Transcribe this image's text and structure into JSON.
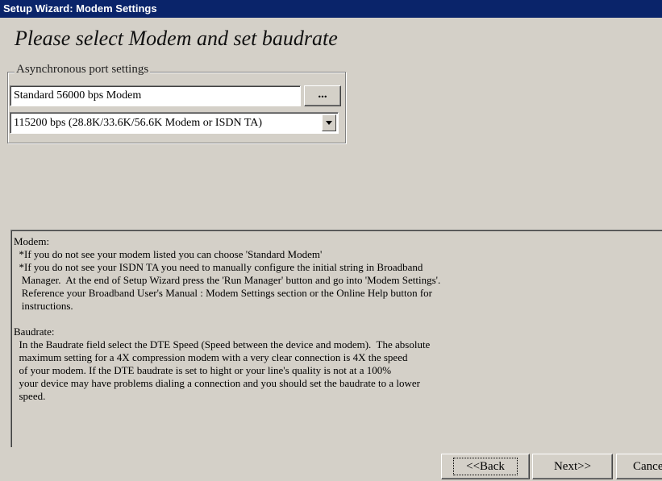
{
  "window": {
    "title": "Setup Wizard: Modem Settings"
  },
  "heading": "Please select Modem and set baudrate",
  "port_settings": {
    "group_label": "Asynchronous port settings",
    "modem_value": "Standard 56000 bps Modem",
    "browse_label": "...",
    "baud_selected": "115200 bps (28.8K/33.6K/56.6K Modem or ISDN TA)"
  },
  "info_text": {
    "lines": [
      "Modem:",
      "  *If you do not see your modem listed you can choose 'Standard Modem'",
      "  *If you do not see your ISDN TA you need to manually configure the initial string in Broadband",
      "   Manager.  At the end of Setup Wizard press the 'Run Manager' button and go into 'Modem Settings'.",
      "   Reference your Broadband User's Manual : Modem Settings section or the Online Help button for",
      "   instructions.",
      "",
      "Baudrate:",
      "  In the Baudrate field select the DTE Speed (Speed between the device and modem).  The absolute",
      "  maximum setting for a 4X compression modem with a very clear connection is 4X the speed",
      "  of your modem. If the DTE baudrate is set to hight or your line's quality is not at a 100%",
      "  your device may have problems dialing a connection and you should set the baudrate to a lower",
      "  speed."
    ]
  },
  "buttons": {
    "back": "<<Back",
    "next": "Next>>",
    "cancel": "Cancel"
  }
}
